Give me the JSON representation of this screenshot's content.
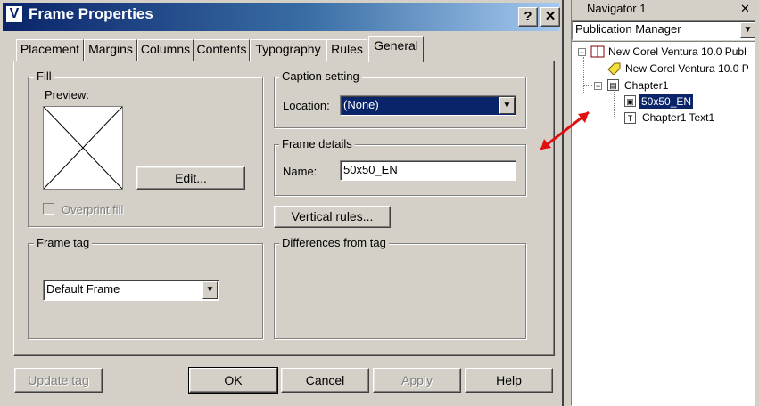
{
  "dialog": {
    "title": "Frame Properties",
    "app_icon_letter": "V",
    "help_glyph": "?",
    "close_glyph": "✕",
    "tabs": [
      {
        "label": "Placement"
      },
      {
        "label": "Margins"
      },
      {
        "label": "Columns"
      },
      {
        "label": "Contents"
      },
      {
        "label": "Typography"
      },
      {
        "label": "Rules"
      },
      {
        "label": "General"
      }
    ],
    "active_tab": "General",
    "fill": {
      "legend": "Fill",
      "preview_label": "Preview:",
      "edit_button": "Edit...",
      "overprint_label": "Overprint fill",
      "overprint_checked": false
    },
    "caption_setting": {
      "legend": "Caption setting",
      "location_label": "Location:",
      "location_value": "(None)"
    },
    "frame_details": {
      "legend": "Frame details",
      "name_label": "Name:",
      "name_value": "50x50_EN"
    },
    "vertical_rules_button": "Vertical rules...",
    "frame_tag": {
      "legend": "Frame tag",
      "value": "Default Frame"
    },
    "differences": {
      "legend": "Differences from tag"
    },
    "buttons": {
      "update_tag": "Update tag",
      "ok": "OK",
      "cancel": "Cancel",
      "apply": "Apply",
      "help": "Help"
    }
  },
  "navigator": {
    "title": "Navigator 1",
    "close_glyph": "✕",
    "dropdown_value": "Publication Manager",
    "tree": [
      {
        "label": "New Corel Ventura 10.0 Publ"
      },
      {
        "label": "New Corel Ventura 10.0 P"
      },
      {
        "label": "Chapter1"
      },
      {
        "label": "50x50_EN"
      },
      {
        "label": "Chapter1 Text1"
      }
    ]
  },
  "colors": {
    "title_gradient_start": "#0a246a",
    "title_gradient_end": "#a6caf0",
    "selection": "#0a246a",
    "annotation_arrow": "#e01010"
  }
}
